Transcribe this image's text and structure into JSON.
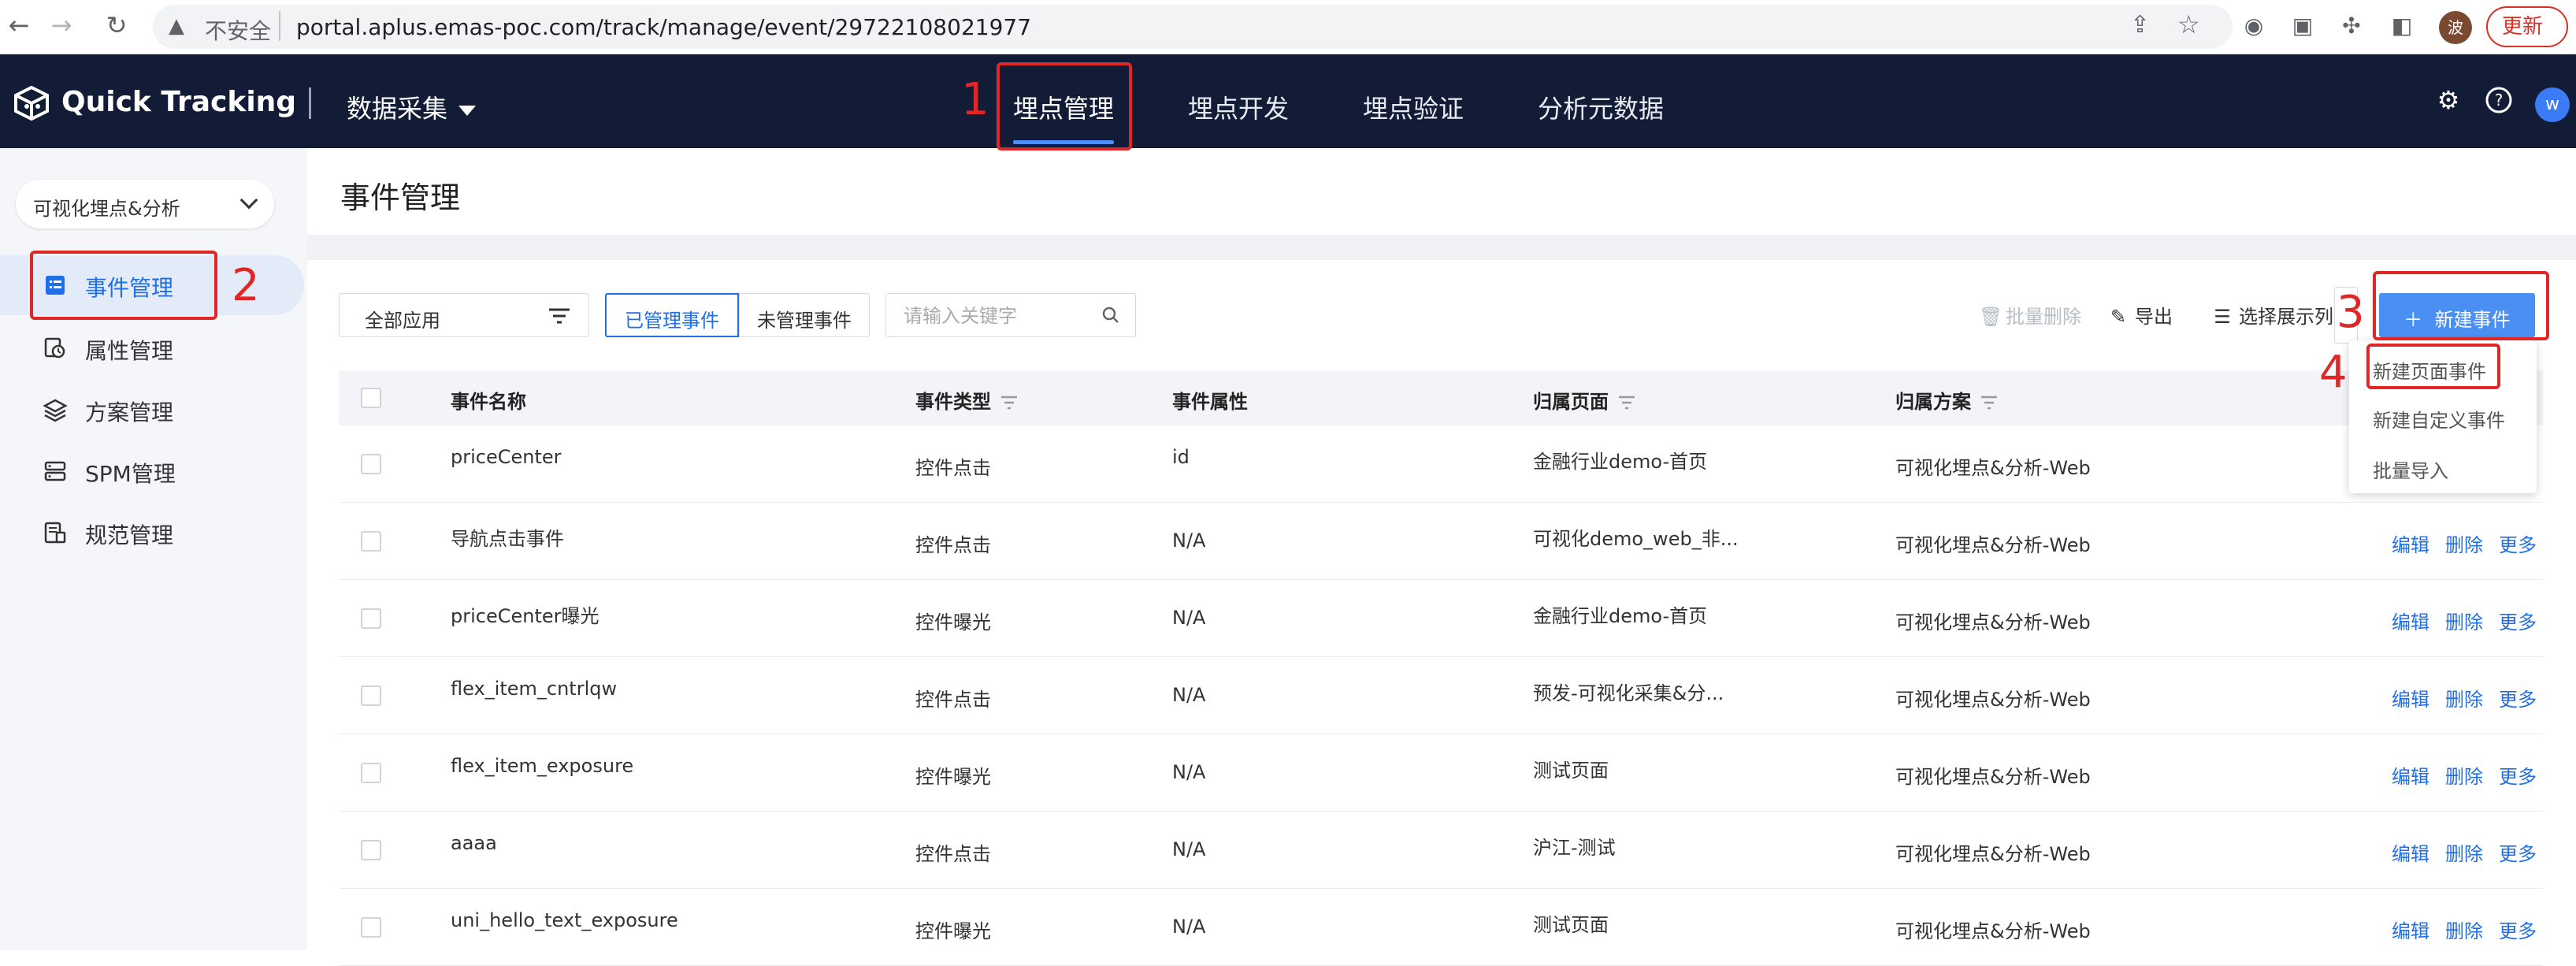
{
  "browser": {
    "insecure_label": "不安全",
    "url": "portal.aplus.emas-poc.com/track/manage/event/29722108021977",
    "profile_initial": "波",
    "update_label": "更新"
  },
  "app": {
    "name": "Quick Tracking",
    "module": "数据采集",
    "nav_tabs": [
      "埋点管理",
      "埋点开发",
      "埋点验证",
      "分析元数据"
    ],
    "user_initial": "w"
  },
  "sidebar": {
    "app_select": "可视化埋点&分析",
    "items": [
      "事件管理",
      "属性管理",
      "方案管理",
      "SPM管理",
      "规范管理"
    ]
  },
  "page": {
    "title": "事件管理",
    "filter_app": "全部应用",
    "seg_managed": "已管理事件",
    "seg_unmanaged": "未管理事件",
    "search_placeholder": "请输入关键字",
    "tool_batch_delete": "批量删除",
    "tool_export": "导出",
    "tool_columns": "选择展示列",
    "new_event": "新建事件"
  },
  "dropdown": [
    "新建页面事件",
    "新建自定义事件",
    "批量导入"
  ],
  "table": {
    "headers": [
      "事件名称",
      "事件类型",
      "事件属性",
      "归属页面",
      "归属方案"
    ],
    "actions": [
      "编辑",
      "删除",
      "更多"
    ],
    "rows": [
      {
        "name": "priceCenter",
        "type": "控件点击",
        "prop": "id",
        "page": "金融行业demo-首页",
        "plan": "可视化埋点&分析-Web"
      },
      {
        "name": "导航点击事件",
        "type": "控件点击",
        "prop": "N/A",
        "page": "可视化demo_web_非...",
        "plan": "可视化埋点&分析-Web"
      },
      {
        "name": "priceCenter曝光",
        "type": "控件曝光",
        "prop": "N/A",
        "page": "金融行业demo-首页",
        "plan": "可视化埋点&分析-Web"
      },
      {
        "name": "flex_item_cntrlqw",
        "type": "控件点击",
        "prop": "N/A",
        "page": "预发-可视化采集&分...",
        "plan": "可视化埋点&分析-Web"
      },
      {
        "name": "flex_item_exposure",
        "type": "控件曝光",
        "prop": "N/A",
        "page": "测试页面",
        "plan": "可视化埋点&分析-Web"
      },
      {
        "name": "aaaa",
        "type": "控件点击",
        "prop": "N/A",
        "page": "沪江-测试",
        "plan": "可视化埋点&分析-Web"
      },
      {
        "name": "uni_hello_text_exposure",
        "type": "控件曝光",
        "prop": "N/A",
        "page": "测试页面",
        "plan": "可视化埋点&分析-Web"
      }
    ]
  },
  "annotations": [
    "1",
    "2",
    "3",
    "4"
  ],
  "colors": {
    "nav_bg": "#121c36",
    "accent": "#1f6fe8",
    "annotation": "#e02727",
    "sidebar_bg": "#f4f6fa"
  }
}
